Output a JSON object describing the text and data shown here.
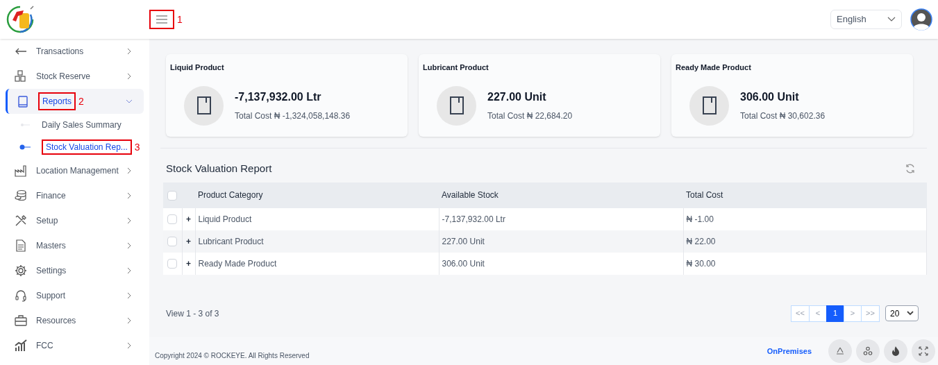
{
  "header": {
    "menu_button": {
      "annotation": "1"
    },
    "language": "English"
  },
  "sidebar": {
    "items": [
      {
        "label": "Transactions",
        "expanded": false,
        "selected": false
      },
      {
        "label": "Stock Reserve",
        "expanded": false,
        "selected": false
      },
      {
        "label": "Reports",
        "expanded": true,
        "selected": true,
        "annotation": "2",
        "children": [
          {
            "label": "Daily Sales Summary",
            "selected": false
          },
          {
            "label": "Stock Valuation Rep...",
            "selected": true,
            "annotation": "3"
          }
        ]
      },
      {
        "label": "Location Management",
        "expanded": false,
        "selected": false
      },
      {
        "label": "Finance",
        "expanded": false,
        "selected": false
      },
      {
        "label": "Setup",
        "expanded": false,
        "selected": false
      },
      {
        "label": "Masters",
        "expanded": false,
        "selected": false
      },
      {
        "label": "Settings",
        "expanded": false,
        "selected": false
      },
      {
        "label": "Support",
        "expanded": false,
        "selected": false
      },
      {
        "label": "Resources",
        "expanded": false,
        "selected": false
      },
      {
        "label": "FCC",
        "expanded": false,
        "selected": false
      }
    ]
  },
  "cards": [
    {
      "title": "Liquid Product",
      "value": "-7,137,932.00 Ltr",
      "total_cost": "Total Cost ₦ -1,324,058,148.36"
    },
    {
      "title": "Lubricant Product",
      "value": "227.00 Unit",
      "total_cost": "Total Cost ₦ 22,684.20"
    },
    {
      "title": "Ready Made Product",
      "value": "306.00 Unit",
      "total_cost": "Total Cost ₦ 30,602.36"
    }
  ],
  "report": {
    "title": "Stock Valuation Report",
    "table": {
      "header_checked": false,
      "columns": [
        "Product Category",
        "Available Stock",
        "Total Cost"
      ],
      "rows": [
        {
          "checked": false,
          "expand": "+",
          "cells": [
            "Liquid Product",
            "-7,137,932.00 Ltr",
            "₦ -1.00"
          ]
        },
        {
          "checked": false,
          "expand": "+",
          "cells": [
            "Lubricant Product",
            "227.00 Unit",
            "₦ 22.00"
          ]
        },
        {
          "checked": false,
          "expand": "+",
          "cells": [
            "Ready Made Product",
            "306.00 Unit",
            "₦ 30.00"
          ]
        }
      ]
    },
    "view_info": "View 1 - 3 of 3",
    "pagination": [
      {
        "label": "<<",
        "selected": false
      },
      {
        "label": "<",
        "selected": false
      },
      {
        "label": "1",
        "selected": true
      },
      {
        "label": ">",
        "selected": false
      },
      {
        "label": ">>",
        "selected": false
      }
    ],
    "page_size": "20"
  },
  "footer": {
    "copyright": "Copyright 2024 © ROCKEYE. All Rights Reserved",
    "mode": "OnPremises"
  }
}
